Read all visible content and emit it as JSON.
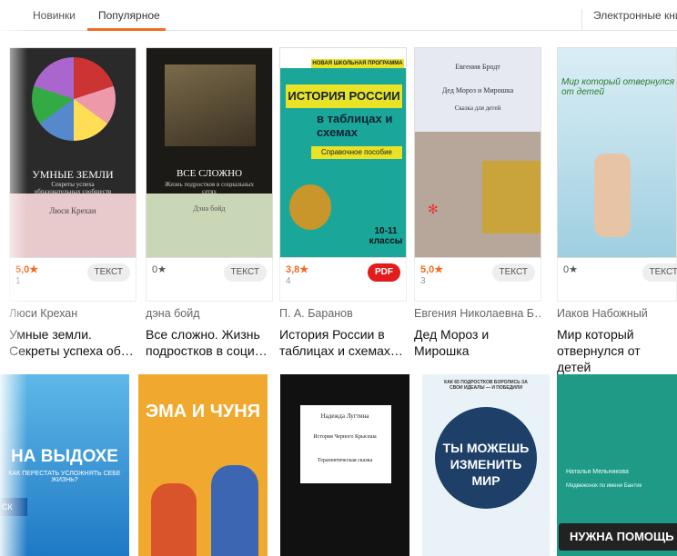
{
  "nav": {
    "tabs": [
      {
        "label": "Новинки"
      },
      {
        "label": "Популярное"
      }
    ],
    "right_label": "Электронные книги"
  },
  "books": [
    {
      "cover": {
        "title": "УМНЫЕ ЗЕМЛИ",
        "subtitle": "Секреты успеха образовательных сообществ",
        "author": "Люси Крехан"
      },
      "rating": "5,0★",
      "count": "1",
      "badge": "ТЕКСТ",
      "author": "Люси Крехан",
      "title": "Умные земли. Секреты успеха об…"
    },
    {
      "cover": {
        "title": "ВСЕ СЛОЖНО",
        "subtitle": "Жизнь подростков в социальных сетях",
        "author": "Дэна бойд"
      },
      "rating": "0★",
      "count": "",
      "badge": "ТЕКСТ",
      "author": "дэна бойд",
      "title": "Все сложно. Жизнь подростков в соци…"
    },
    {
      "cover": {
        "series": "НОВАЯ ШКОЛЬНАЯ ПРОГРАММА",
        "title": "ИСТОРИЯ РОССИИ",
        "title2": "в таблицах и схемах",
        "subtitle": "Справочное пособие",
        "grade": "10-11 классы"
      },
      "rating": "3,8★",
      "count": "4",
      "badge": "PDF",
      "author": "П. А. Баранов",
      "title": "История России в таблицах и схемах…"
    },
    {
      "cover": {
        "author": "Евгения Бродт",
        "title": "Дед Мороз и Мирошка",
        "subtitle": "Сказка для детей"
      },
      "rating": "5,0★",
      "count": "3",
      "badge": "ТЕКСТ",
      "author": "Евгения Николаевна Б…",
      "title": "Дед Мороз и Мирошка"
    },
    {
      "cover": {
        "title": "Мир который отвернулся от детей"
      },
      "rating": "0★",
      "count": "",
      "badge": "ТЕКСТ",
      "author": "Иаков Набожный",
      "title": "Мир который отвернулся от детей"
    }
  ],
  "row2": [
    {
      "title": "НА ВЫДОХЕ",
      "subtitle": "КАК ПЕРЕСТАТЬ УСЛОЖНЯТЬ СЕБЕ ЖИЗНЬ?",
      "button": "СК"
    },
    {
      "title": "ЭМА И ЧУНЯ"
    },
    {
      "author": "Надежда Лугтина",
      "title": "История Черного Крысеша",
      "subtitle": "Терапевтическая сказка"
    },
    {
      "series": "КАК 65 ПОДРОСТКОВ БОРОЛИСЬ ЗА СВОИ ИДЕАЛЫ — И ПОБЕДИЛИ",
      "title": "ТЫ МОЖЕШЬ ИЗМЕНИТЬ МИР"
    },
    {
      "author": "Наталья Мельникова",
      "title": "Медвежонок по имени Бантик"
    }
  ],
  "help_button": "НУЖНА ПОМОЩЬ",
  "colors": {
    "accent": "#f26b21",
    "pdf": "#e21b1b"
  }
}
